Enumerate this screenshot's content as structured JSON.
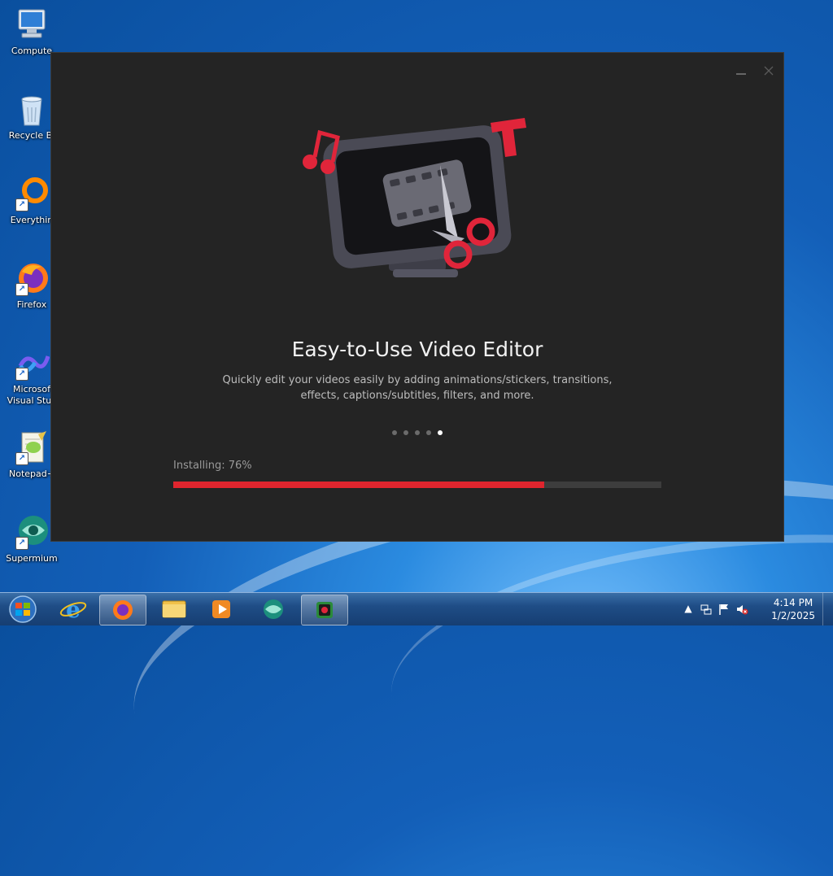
{
  "desktop": {
    "icons": [
      {
        "label": "Compute",
        "icon": "computer-icon"
      },
      {
        "label": "Recycle Bi",
        "icon": "recycle-bin-icon"
      },
      {
        "label": "Everythin",
        "icon": "everything-icon"
      },
      {
        "label": "Firefox",
        "icon": "firefox-icon"
      },
      {
        "label": "Microsof",
        "label2": "Visual Stuc",
        "icon": "visual-studio-icon"
      },
      {
        "label": "Notepad+",
        "icon": "notepad-plus-plus-icon"
      },
      {
        "label": "Supermium",
        "icon": "supermium-icon"
      }
    ]
  },
  "installer": {
    "headline": "Easy-to-Use Video Editor",
    "description": "Quickly edit your videos easily by adding animations/stickers, transitions, effects, captions/subtitles, filters, and more.",
    "carousel": {
      "total": 5,
      "active_index": 4
    },
    "status_text": "Installing: 76%",
    "progress": 0.76,
    "accent_color": "#e0252e",
    "minimize_icon": "minimize-icon",
    "close_icon": "close-icon"
  },
  "taskbar": {
    "start_icon": "windows-start-icon",
    "pinned": [
      "internet-explorer-icon",
      "firefox-icon",
      "file-explorer-icon",
      "media-player-icon",
      "supermium-icon",
      "installer-app-icon"
    ],
    "active_item": "installer-app-icon",
    "clock": {
      "time": "4:14 PM",
      "date": "1/2/2025"
    }
  }
}
